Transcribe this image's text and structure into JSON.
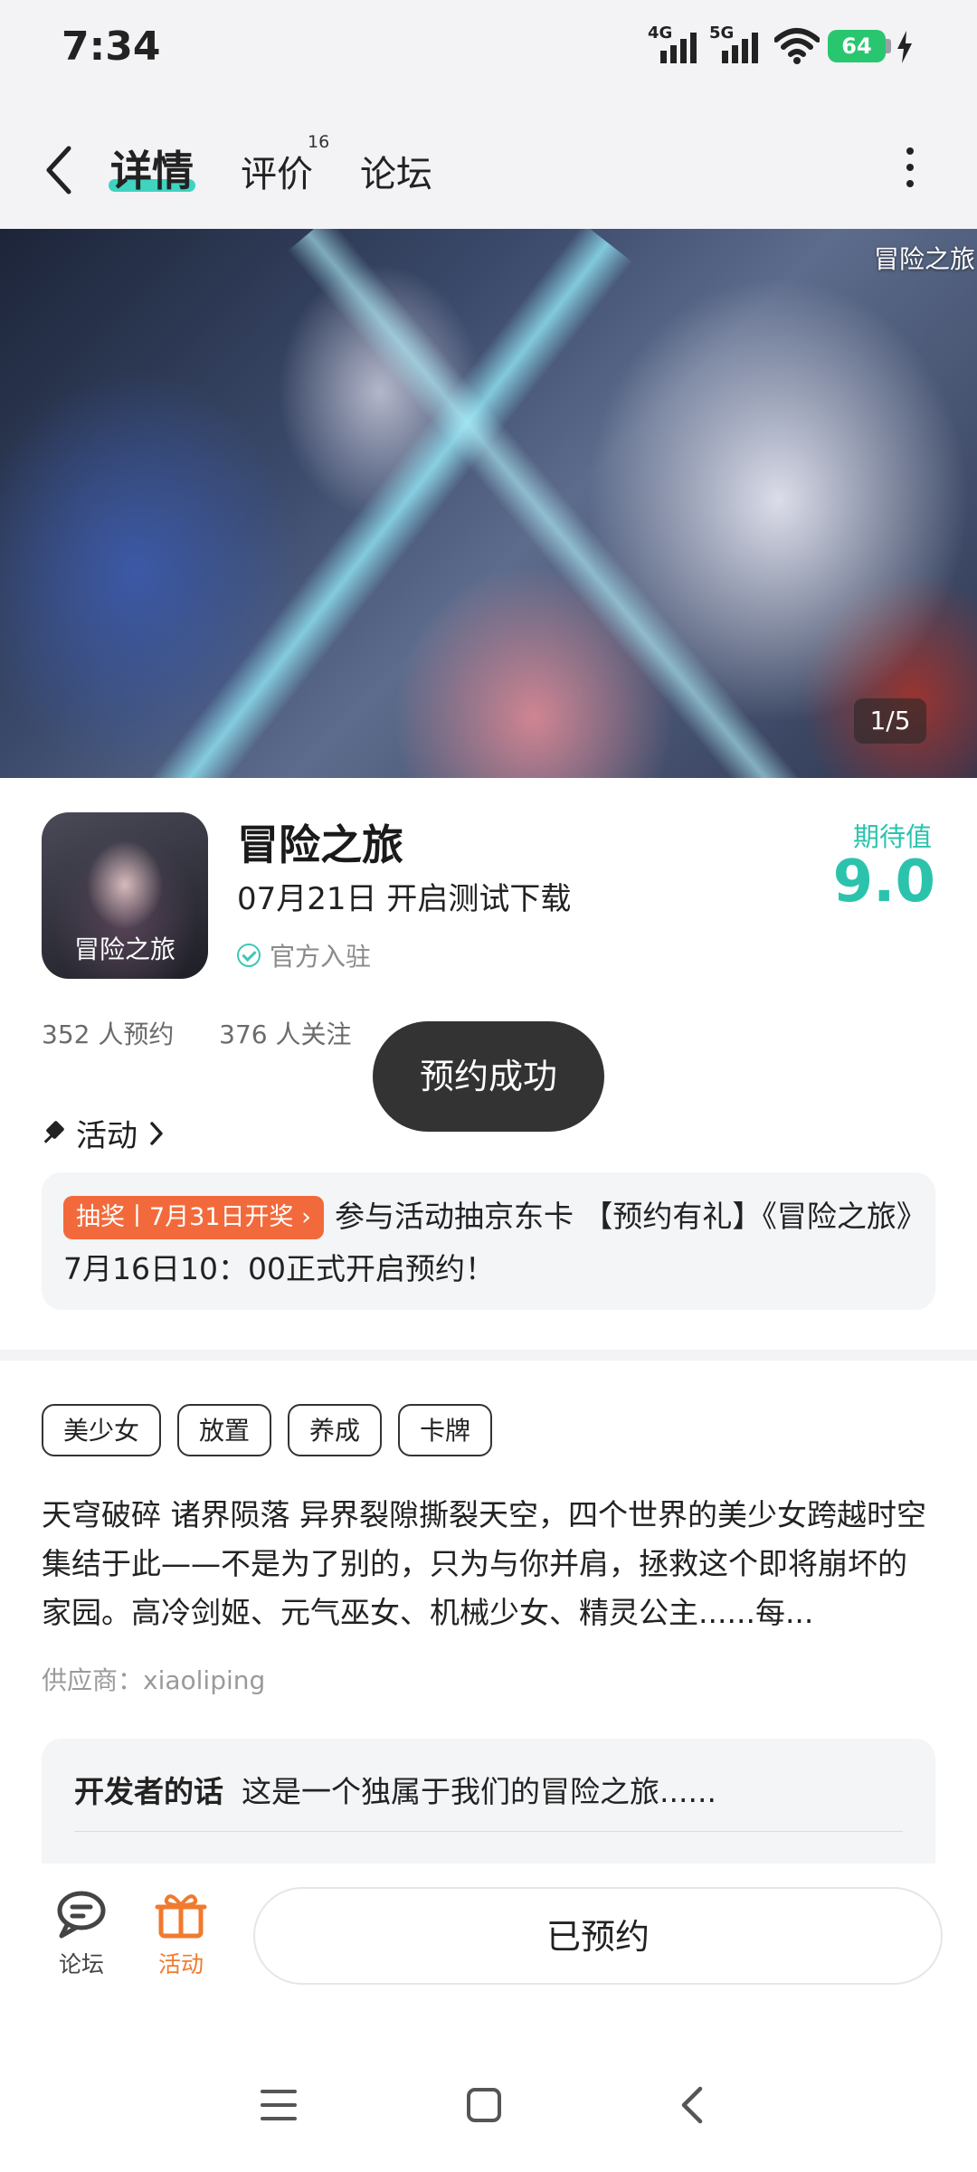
{
  "status_bar": {
    "time": "7:34",
    "network_1": "4G",
    "network_2": "5G",
    "battery": "64"
  },
  "top_nav": {
    "tabs": [
      {
        "label": "详情",
        "active": true
      },
      {
        "label": "评价",
        "badge": "16"
      },
      {
        "label": "论坛"
      }
    ]
  },
  "banner": {
    "logo_text": "冒险之旅",
    "page_indicator": "1/5"
  },
  "game": {
    "title": "冒险之旅",
    "release": "07月21日 开启测试下载",
    "official": "官方入驻",
    "icon_text": "冒险之旅",
    "score_label": "期待值",
    "score": "9.0",
    "reservations": "352 人预约",
    "followers": "376 人关注"
  },
  "toast": {
    "text": "预约成功"
  },
  "activity": {
    "heading": "活动",
    "tag": "抽奖丨7月31日开奖",
    "text": "参与活动抽京东卡 【预约有礼】《冒险之旅》7月16日10：00正式开启预约！"
  },
  "tags": [
    "美少女",
    "放置",
    "养成",
    "卡牌"
  ],
  "description": "天穹破碎 诸界陨落 异界裂隙撕裂天空，四个世界的美少女跨越时空集结于此——不是为了别的，只为与你并肩，拯救这个即将崩坏的家园。高冷剑姬、元气巫女、机械少女、精灵公主......每...",
  "supplier": "供应商：xiaoliping",
  "developer": {
    "label": "开发者的话",
    "text": "这是一个独属于我们的冒险之旅......"
  },
  "bottom_bar": {
    "forum": "论坛",
    "activity": "活动",
    "reserved": "已预约"
  },
  "colors": {
    "accent": "#2cc3ad",
    "tab_underline": "#3fd3c0",
    "lottery_tag": "#f26a3b",
    "activity_icon": "#f07a2f"
  }
}
